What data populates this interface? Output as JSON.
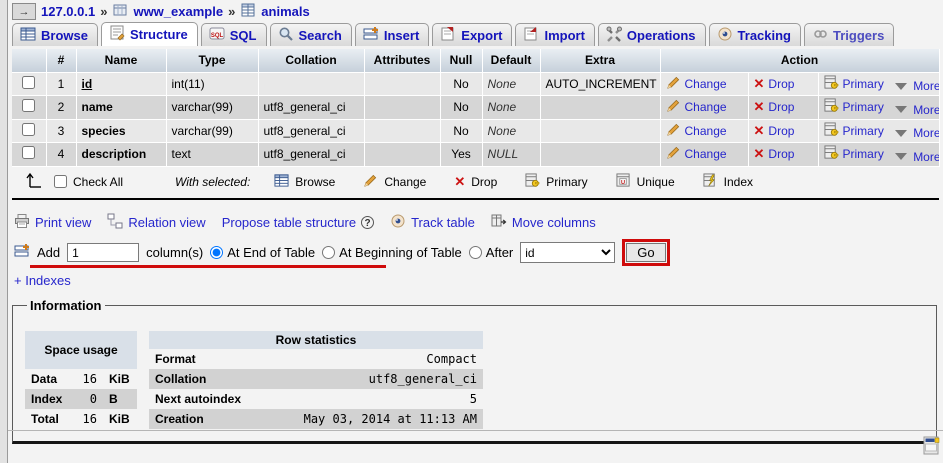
{
  "nav": {
    "expand_arrow": "→"
  },
  "breadcrumb": {
    "server": "127.0.0.1",
    "sep1": "»",
    "database": "www_example",
    "sep2": "»",
    "table": "animals"
  },
  "tabs": [
    {
      "label": "Browse"
    },
    {
      "label": "Structure"
    },
    {
      "label": "SQL"
    },
    {
      "label": "Search"
    },
    {
      "label": "Insert"
    },
    {
      "label": "Export"
    },
    {
      "label": "Import"
    },
    {
      "label": "Operations"
    },
    {
      "label": "Tracking"
    },
    {
      "label": "Triggers"
    }
  ],
  "structure_table": {
    "headers": {
      "num": "#",
      "name": "Name",
      "type": "Type",
      "collation": "Collation",
      "attributes": "Attributes",
      "null": "Null",
      "default": "Default",
      "extra": "Extra",
      "action": "Action"
    },
    "action_labels": {
      "change": "Change",
      "drop": "Drop",
      "primary": "Primary",
      "more": "More"
    },
    "rows": [
      {
        "num": "1",
        "name": "id",
        "type": "int(11)",
        "collation": "",
        "attributes": "",
        "null": "No",
        "default": "None",
        "extra": "AUTO_INCREMENT"
      },
      {
        "num": "2",
        "name": "name",
        "type": "varchar(99)",
        "collation": "utf8_general_ci",
        "attributes": "",
        "null": "No",
        "default": "None",
        "extra": ""
      },
      {
        "num": "3",
        "name": "species",
        "type": "varchar(99)",
        "collation": "utf8_general_ci",
        "attributes": "",
        "null": "No",
        "default": "None",
        "extra": ""
      },
      {
        "num": "4",
        "name": "description",
        "type": "text",
        "collation": "utf8_general_ci",
        "attributes": "",
        "null": "Yes",
        "default": "NULL",
        "extra": ""
      }
    ]
  },
  "selection_bar": {
    "check_all": "Check All",
    "with_selected": "With selected:",
    "actions": [
      "Browse",
      "Change",
      "Drop",
      "Primary",
      "Unique",
      "Index"
    ]
  },
  "tools_bar": {
    "print_view": "Print view",
    "relation_view": "Relation view",
    "propose": "Propose table structure",
    "help": "?",
    "track_table": "Track table",
    "move_columns": "Move columns"
  },
  "add_column": {
    "add": "Add",
    "count": "1",
    "columns": "column(s)",
    "at_end": "At End of Table",
    "at_beginning": "At Beginning of Table",
    "after": "After",
    "after_value": "id",
    "go": "Go"
  },
  "indexes_link": "+ Indexes",
  "information": {
    "legend": "Information",
    "space_usage": {
      "title": "Space usage",
      "rows": [
        {
          "label": "Data",
          "value": "16",
          "unit": "KiB"
        },
        {
          "label": "Index",
          "value": "0",
          "unit": "B"
        },
        {
          "label": "Total",
          "value": "16",
          "unit": "KiB"
        }
      ]
    },
    "row_statistics": {
      "title": "Row statistics",
      "rows": [
        {
          "label": "Format",
          "value": "Compact"
        },
        {
          "label": "Collation",
          "value": "utf8_general_ci"
        },
        {
          "label": "Next autoindex",
          "value": "5"
        },
        {
          "label": "Creation",
          "value": "May 03, 2014 at 11:13 AM"
        }
      ]
    }
  }
}
